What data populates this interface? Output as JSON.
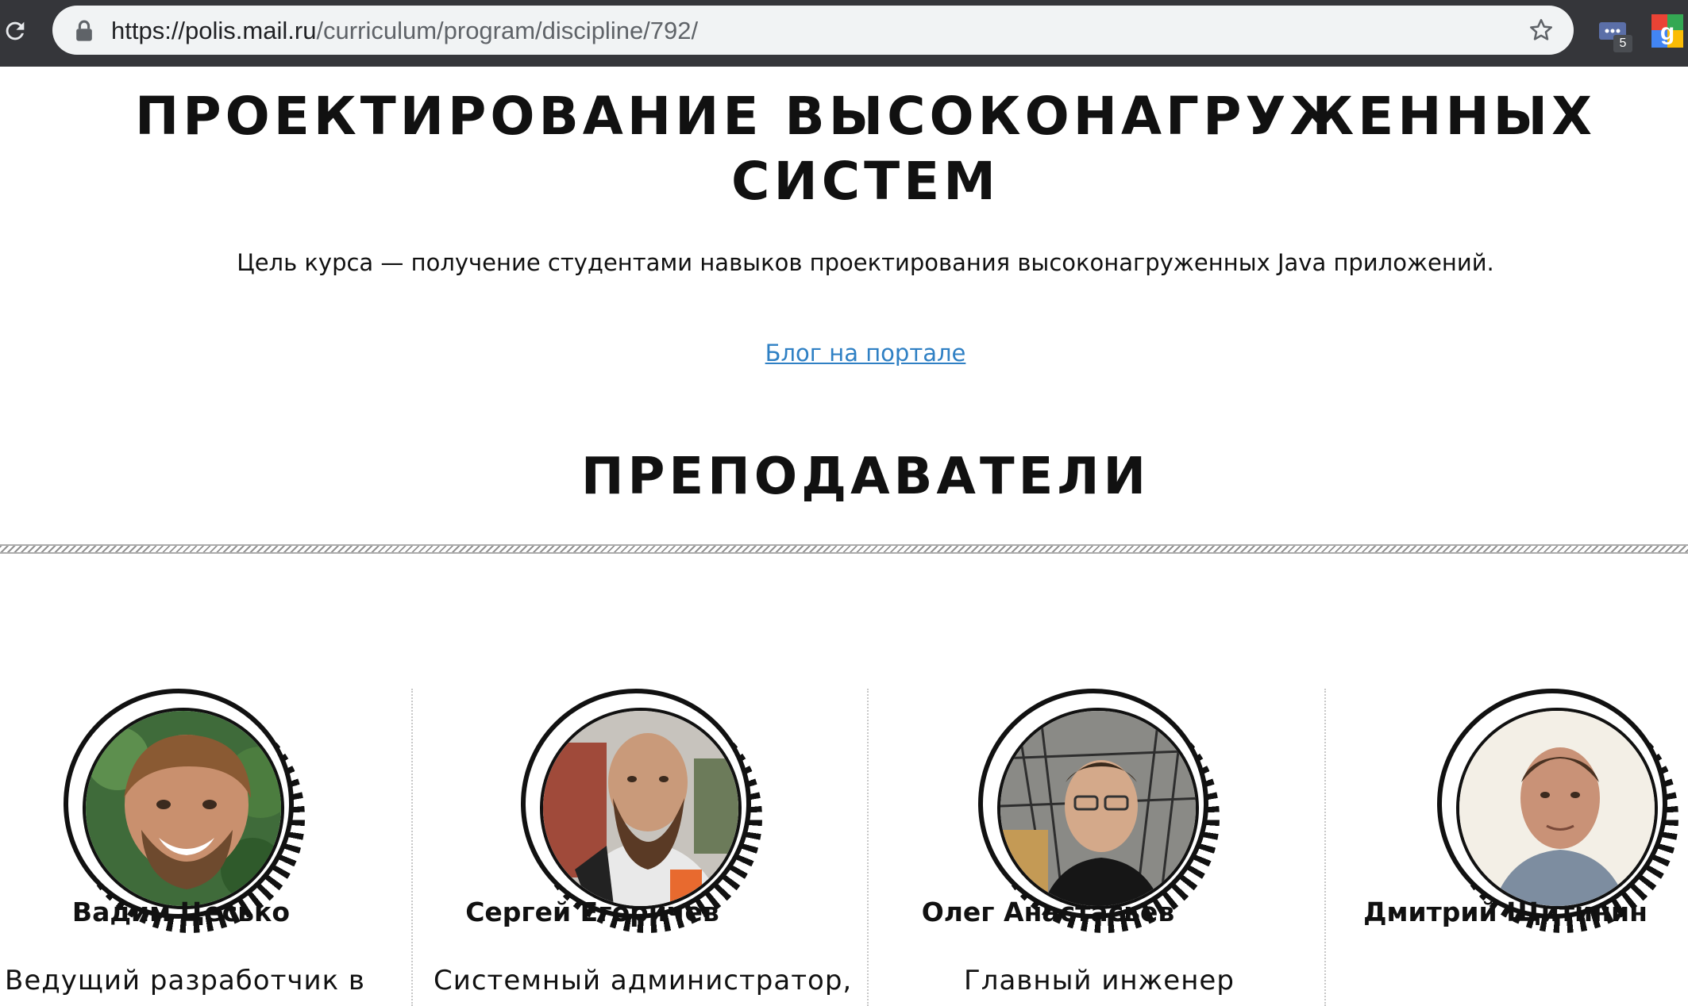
{
  "browser": {
    "url_host": "https://polis.mail.ru",
    "url_path": "/curriculum/program/discipline/792/",
    "extension_badge": "5"
  },
  "course": {
    "title_line1": "ПРОЕКТИРОВАНИЕ ВЫСОКОНАГРУЖЕННЫХ",
    "title_line2": "СИСТЕМ",
    "goal": "Цель курса — получение студентами навыков проектирования высоконагруженных Java приложений.",
    "blog_link": "Блог на портале"
  },
  "teachers_heading": "ПРЕПОДАВАТЕЛИ",
  "teachers": [
    {
      "name": "Вадим Цесько",
      "role": "Ведущий разработчик в"
    },
    {
      "name": "Сергей Егоричев",
      "role": "Системный администратор,"
    },
    {
      "name": "Олег Анастасьев",
      "role": "Главный инженер"
    },
    {
      "name": "Дмитрий Щитинин",
      "role": ""
    }
  ],
  "colors": {
    "chrome_bg": "#35363a",
    "omnibox_bg": "#f1f3f4",
    "link": "#2f80c4"
  }
}
